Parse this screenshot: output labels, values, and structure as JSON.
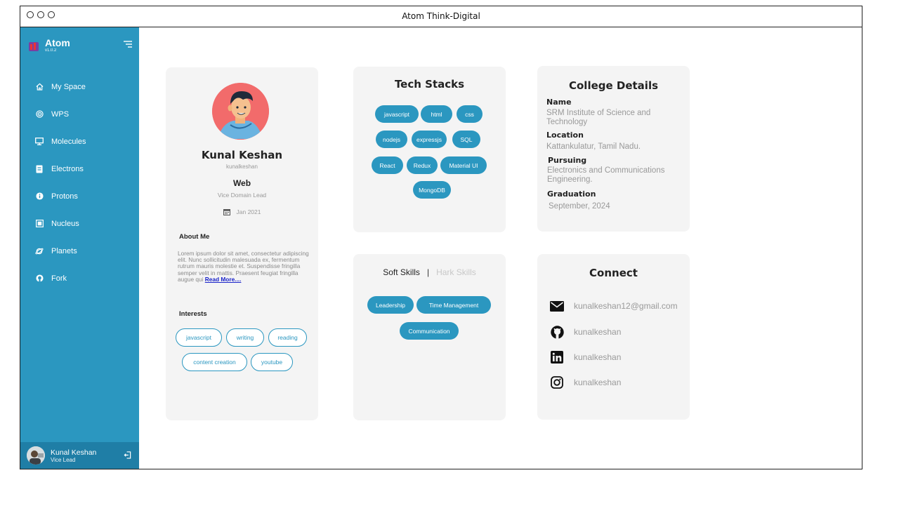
{
  "window": {
    "title": "Atom Think-Digital"
  },
  "sidebar": {
    "brand": {
      "name": "Atom",
      "version": "v1.0.2"
    },
    "items": [
      {
        "label": "My Space",
        "icon": "home-icon"
      },
      {
        "label": "WPS",
        "icon": "target-icon"
      },
      {
        "label": "Molecules",
        "icon": "monitor-icon"
      },
      {
        "label": "Electrons",
        "icon": "document-icon"
      },
      {
        "label": "Protons",
        "icon": "info-circle-icon"
      },
      {
        "label": "Nucleus",
        "icon": "image-icon"
      },
      {
        "label": "Planets",
        "icon": "planet-icon"
      },
      {
        "label": "Fork",
        "icon": "github-icon"
      }
    ],
    "user": {
      "name": "Kunal Keshan",
      "role": "Vice Lead"
    }
  },
  "profile": {
    "name": "Kunal Keshan",
    "handle": "kunalkeshan",
    "domain": "Web",
    "role": "Vice Domain Lead",
    "joined": "Jan 2021",
    "about_heading": "About Me",
    "about_text": "Lorem ipsum dolor sit amet, consectetur adipiscing elit. Nunc sollicitudin malesuada ex, fermentum rutrum mauris molestie et. Suspendisse fringilla semper velit in mattis. Praesent feugiat fringilla augue qui",
    "read_more": "Read More....",
    "interests_heading": "Interests",
    "interests": [
      "javascript",
      "writing",
      "reading",
      "content creation",
      "youtube"
    ]
  },
  "tech_stacks": {
    "title": "Tech Stacks",
    "items": [
      "javascript",
      "html",
      "css",
      "nodejs",
      "expressjs",
      "SQL",
      "React",
      "Redux",
      "Material UI",
      "MongoDB"
    ]
  },
  "skills": {
    "tab_soft": "Soft Skills",
    "separator": "|",
    "tab_hard": "Hark Skills",
    "items": [
      "Leadership",
      "Time Management",
      "Communication"
    ]
  },
  "college": {
    "title": "College Details",
    "name_label": "Name",
    "name_value": "SRM Institute of Science and Technology",
    "location_label": "Location",
    "location_value": "Kattankulatur, Tamil Nadu.",
    "pursuing_label": "Pursuing",
    "pursuing_value": "Electronics and Communications Engineering.",
    "graduation_label": "Graduation",
    "graduation_value": "September, 2024"
  },
  "connect": {
    "title": "Connect",
    "email": "kunalkeshan12@gmail.com",
    "github": "kunalkeshan",
    "linkedin": "kunalkeshan",
    "instagram": "kunalkeshan"
  },
  "colors": {
    "accent": "#2b97c0",
    "card": "#f4f4f4",
    "muted": "#999999"
  }
}
